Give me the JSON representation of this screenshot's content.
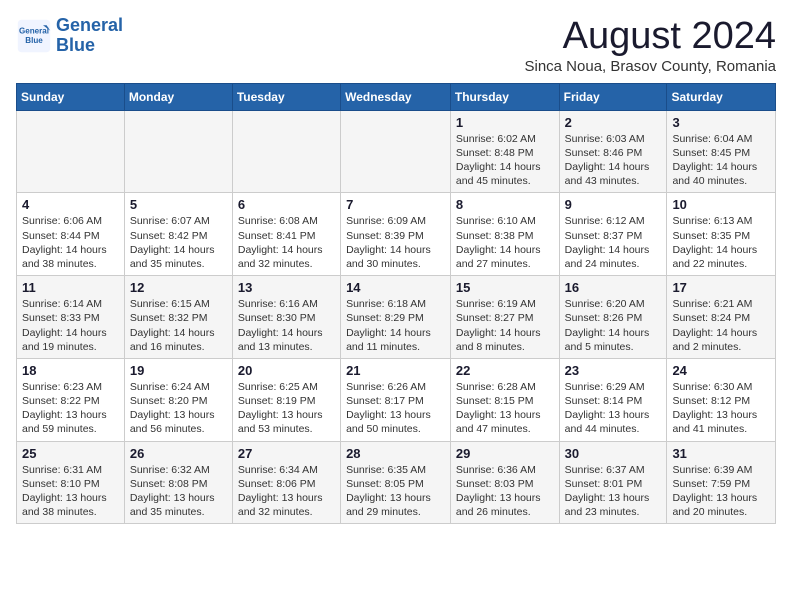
{
  "header": {
    "logo_line1": "General",
    "logo_line2": "Blue",
    "title": "August 2024",
    "subtitle": "Sinca Noua, Brasov County, Romania"
  },
  "calendar": {
    "days_of_week": [
      "Sunday",
      "Monday",
      "Tuesday",
      "Wednesday",
      "Thursday",
      "Friday",
      "Saturday"
    ],
    "weeks": [
      [
        {
          "day": "",
          "info": ""
        },
        {
          "day": "",
          "info": ""
        },
        {
          "day": "",
          "info": ""
        },
        {
          "day": "",
          "info": ""
        },
        {
          "day": "1",
          "info": "Sunrise: 6:02 AM\nSunset: 8:48 PM\nDaylight: 14 hours\nand 45 minutes."
        },
        {
          "day": "2",
          "info": "Sunrise: 6:03 AM\nSunset: 8:46 PM\nDaylight: 14 hours\nand 43 minutes."
        },
        {
          "day": "3",
          "info": "Sunrise: 6:04 AM\nSunset: 8:45 PM\nDaylight: 14 hours\nand 40 minutes."
        }
      ],
      [
        {
          "day": "4",
          "info": "Sunrise: 6:06 AM\nSunset: 8:44 PM\nDaylight: 14 hours\nand 38 minutes."
        },
        {
          "day": "5",
          "info": "Sunrise: 6:07 AM\nSunset: 8:42 PM\nDaylight: 14 hours\nand 35 minutes."
        },
        {
          "day": "6",
          "info": "Sunrise: 6:08 AM\nSunset: 8:41 PM\nDaylight: 14 hours\nand 32 minutes."
        },
        {
          "day": "7",
          "info": "Sunrise: 6:09 AM\nSunset: 8:39 PM\nDaylight: 14 hours\nand 30 minutes."
        },
        {
          "day": "8",
          "info": "Sunrise: 6:10 AM\nSunset: 8:38 PM\nDaylight: 14 hours\nand 27 minutes."
        },
        {
          "day": "9",
          "info": "Sunrise: 6:12 AM\nSunset: 8:37 PM\nDaylight: 14 hours\nand 24 minutes."
        },
        {
          "day": "10",
          "info": "Sunrise: 6:13 AM\nSunset: 8:35 PM\nDaylight: 14 hours\nand 22 minutes."
        }
      ],
      [
        {
          "day": "11",
          "info": "Sunrise: 6:14 AM\nSunset: 8:33 PM\nDaylight: 14 hours\nand 19 minutes."
        },
        {
          "day": "12",
          "info": "Sunrise: 6:15 AM\nSunset: 8:32 PM\nDaylight: 14 hours\nand 16 minutes."
        },
        {
          "day": "13",
          "info": "Sunrise: 6:16 AM\nSunset: 8:30 PM\nDaylight: 14 hours\nand 13 minutes."
        },
        {
          "day": "14",
          "info": "Sunrise: 6:18 AM\nSunset: 8:29 PM\nDaylight: 14 hours\nand 11 minutes."
        },
        {
          "day": "15",
          "info": "Sunrise: 6:19 AM\nSunset: 8:27 PM\nDaylight: 14 hours\nand 8 minutes."
        },
        {
          "day": "16",
          "info": "Sunrise: 6:20 AM\nSunset: 8:26 PM\nDaylight: 14 hours\nand 5 minutes."
        },
        {
          "day": "17",
          "info": "Sunrise: 6:21 AM\nSunset: 8:24 PM\nDaylight: 14 hours\nand 2 minutes."
        }
      ],
      [
        {
          "day": "18",
          "info": "Sunrise: 6:23 AM\nSunset: 8:22 PM\nDaylight: 13 hours\nand 59 minutes."
        },
        {
          "day": "19",
          "info": "Sunrise: 6:24 AM\nSunset: 8:20 PM\nDaylight: 13 hours\nand 56 minutes."
        },
        {
          "day": "20",
          "info": "Sunrise: 6:25 AM\nSunset: 8:19 PM\nDaylight: 13 hours\nand 53 minutes."
        },
        {
          "day": "21",
          "info": "Sunrise: 6:26 AM\nSunset: 8:17 PM\nDaylight: 13 hours\nand 50 minutes."
        },
        {
          "day": "22",
          "info": "Sunrise: 6:28 AM\nSunset: 8:15 PM\nDaylight: 13 hours\nand 47 minutes."
        },
        {
          "day": "23",
          "info": "Sunrise: 6:29 AM\nSunset: 8:14 PM\nDaylight: 13 hours\nand 44 minutes."
        },
        {
          "day": "24",
          "info": "Sunrise: 6:30 AM\nSunset: 8:12 PM\nDaylight: 13 hours\nand 41 minutes."
        }
      ],
      [
        {
          "day": "25",
          "info": "Sunrise: 6:31 AM\nSunset: 8:10 PM\nDaylight: 13 hours\nand 38 minutes."
        },
        {
          "day": "26",
          "info": "Sunrise: 6:32 AM\nSunset: 8:08 PM\nDaylight: 13 hours\nand 35 minutes."
        },
        {
          "day": "27",
          "info": "Sunrise: 6:34 AM\nSunset: 8:06 PM\nDaylight: 13 hours\nand 32 minutes."
        },
        {
          "day": "28",
          "info": "Sunrise: 6:35 AM\nSunset: 8:05 PM\nDaylight: 13 hours\nand 29 minutes."
        },
        {
          "day": "29",
          "info": "Sunrise: 6:36 AM\nSunset: 8:03 PM\nDaylight: 13 hours\nand 26 minutes."
        },
        {
          "day": "30",
          "info": "Sunrise: 6:37 AM\nSunset: 8:01 PM\nDaylight: 13 hours\nand 23 minutes."
        },
        {
          "day": "31",
          "info": "Sunrise: 6:39 AM\nSunset: 7:59 PM\nDaylight: 13 hours\nand 20 minutes."
        }
      ]
    ]
  }
}
